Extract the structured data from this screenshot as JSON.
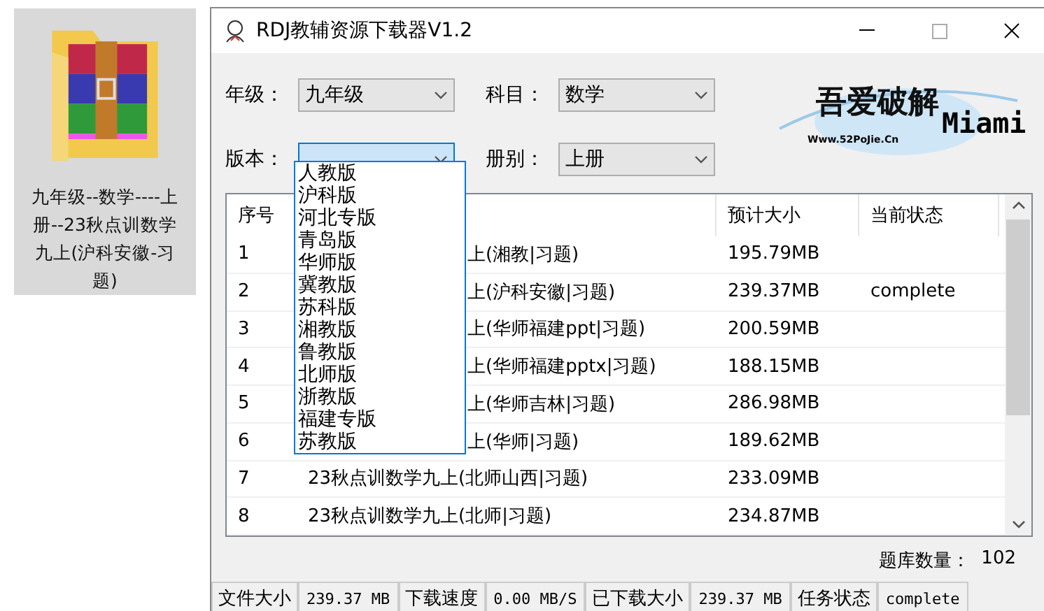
{
  "desktop_icon": {
    "label": "九年级--数学----上册--23秋点训数学九上(沪科安徽-习题)",
    "selected": true
  },
  "window": {
    "title": "RDJ教辅资源下载器V1.2"
  },
  "filters": [
    {
      "label": "年级：",
      "value": "九年级",
      "focused": false
    },
    {
      "label": "科目：",
      "value": "数学",
      "focused": false
    },
    {
      "label": "版本：",
      "focused": true
    },
    {
      "label": "册别：",
      "value": "上册",
      "focused": false
    }
  ],
  "logo": {
    "title": "吾爱破解",
    "url": "Www.52PoJie.Cn",
    "name": "Miami"
  },
  "dropdown": {
    "options": [
      "人教版",
      "沪科版",
      "河北专版",
      "青岛版",
      "华师版",
      "冀教版",
      "苏科版",
      "湘教版",
      "鲁教版",
      "北师版",
      "浙教版",
      "福建专版",
      "苏教版"
    ]
  },
  "table": {
    "columns": {
      "number": "序号",
      "size": "预计大小",
      "status": "当前状态"
    },
    "rows": [
      {
        "number": "1",
        "name": "上(湘教|习题)",
        "partly_hidden": true,
        "size": "195.79MB"
      },
      {
        "number": "2",
        "name": "上(沪科安徽|习题)",
        "partly_hidden": true,
        "size": "239.37MB",
        "status": "complete"
      },
      {
        "number": "3",
        "name": "上(华师福建ppt|习题)",
        "partly_hidden": true,
        "size": "200.59MB"
      },
      {
        "number": "4",
        "name": "上(华师福建pptx|习题)",
        "partly_hidden": true,
        "size": "188.15MB"
      },
      {
        "number": "5",
        "name": "上(华师吉林|习题)",
        "partly_hidden": true,
        "size": "286.98MB"
      },
      {
        "number": "6",
        "name": "上(华师|习题)",
        "partly_hidden": true,
        "size": "189.62MB"
      },
      {
        "number": "7",
        "name": "23秋点训数学九上(北师山西|习题)",
        "partly_hidden": false,
        "size": "233.09MB"
      },
      {
        "number": "8",
        "name": "23秋点训数学九上(北师|习题)",
        "partly_hidden": false,
        "size": "234.87MB"
      }
    ]
  },
  "count": {
    "label": "题库数量：",
    "value": "102"
  },
  "status_bar": [
    {
      "label": "文件大小",
      "value": "239.37 MB"
    },
    {
      "label": "下载速度",
      "value": "0.00 MB/S"
    },
    {
      "label": "已下载大小",
      "value": "239.37 MB"
    },
    {
      "label": "任务状态",
      "value": "complete"
    }
  ]
}
